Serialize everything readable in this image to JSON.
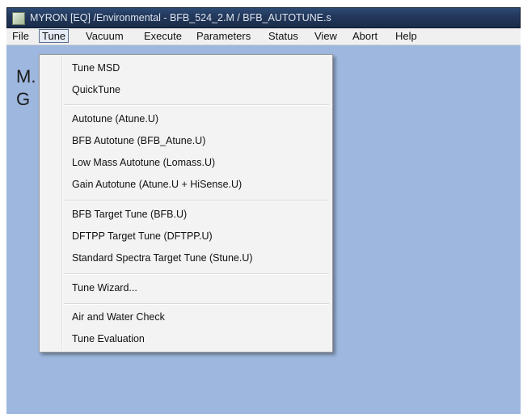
{
  "window": {
    "title": "MYRON [EQ] /Environmental - BFB_524_2.M / BFB_AUTOTUNE.s",
    "icon": "app-icon"
  },
  "menubar": {
    "items": [
      "File",
      "Tune",
      "Vacuum",
      "Execute",
      "Parameters",
      "Status",
      "View",
      "Abort",
      "Help"
    ],
    "active": "Tune"
  },
  "content": {
    "line1": "M.",
    "line2": "G"
  },
  "tune_menu": {
    "group1": [
      "Tune MSD",
      "QuickTune"
    ],
    "group2": [
      "Autotune (Atune.U)",
      "BFB Autotune (BFB_Atune.U)",
      "Low Mass Autotune (Lomass.U)",
      "Gain Autotune (Atune.U + HiSense.U)"
    ],
    "group3": [
      "BFB Target Tune (BFB.U)",
      "DFTPP Target Tune (DFTPP.U)",
      "Standard Spectra Target Tune (Stune.U)"
    ],
    "group4": [
      "Tune Wizard..."
    ],
    "group5": [
      "Air and Water Check",
      "Tune Evaluation"
    ]
  },
  "colors": {
    "titlebar": "#22375a",
    "background": "#9eb7de",
    "menu": "#f3f3f3"
  }
}
